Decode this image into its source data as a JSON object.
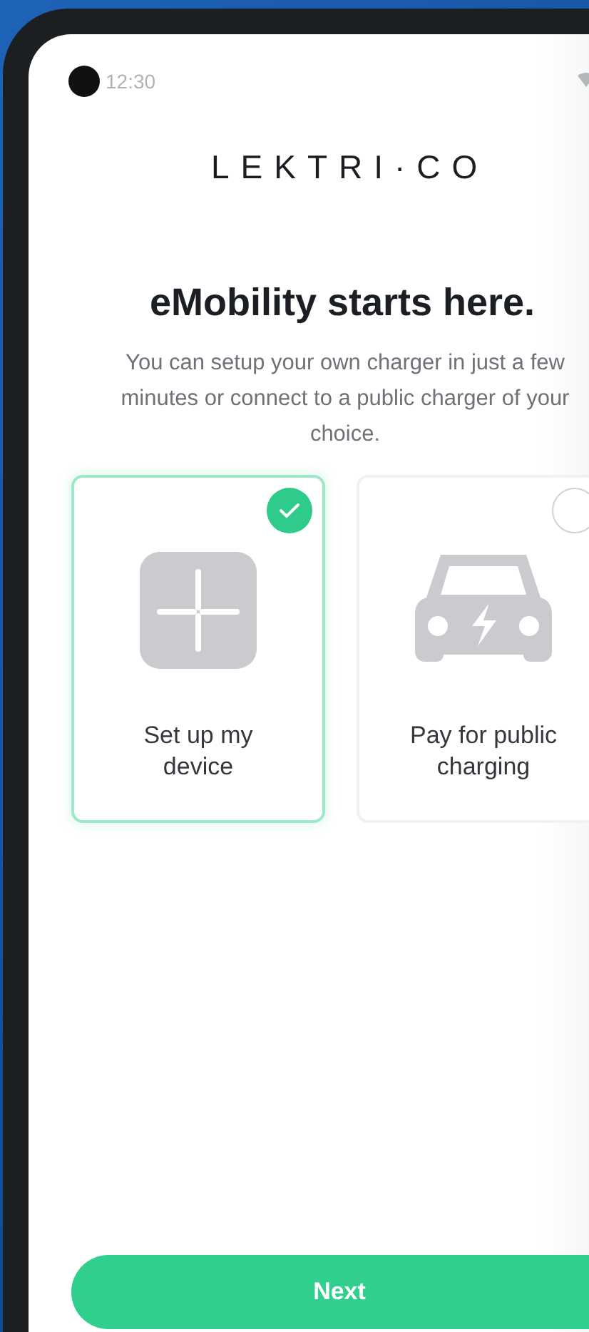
{
  "status_bar": {
    "time": "12:30"
  },
  "logo": "LEKTRI·CO",
  "heading": "eMobility starts here.",
  "description": "You can setup your own charger in just a few minutes or connect to a public charger of your choice.",
  "options": [
    {
      "kind": "device",
      "label": "Set up my device",
      "selected": true
    },
    {
      "kind": "public",
      "label": "Pay for public charging",
      "selected": false
    }
  ],
  "next_button": "Next"
}
